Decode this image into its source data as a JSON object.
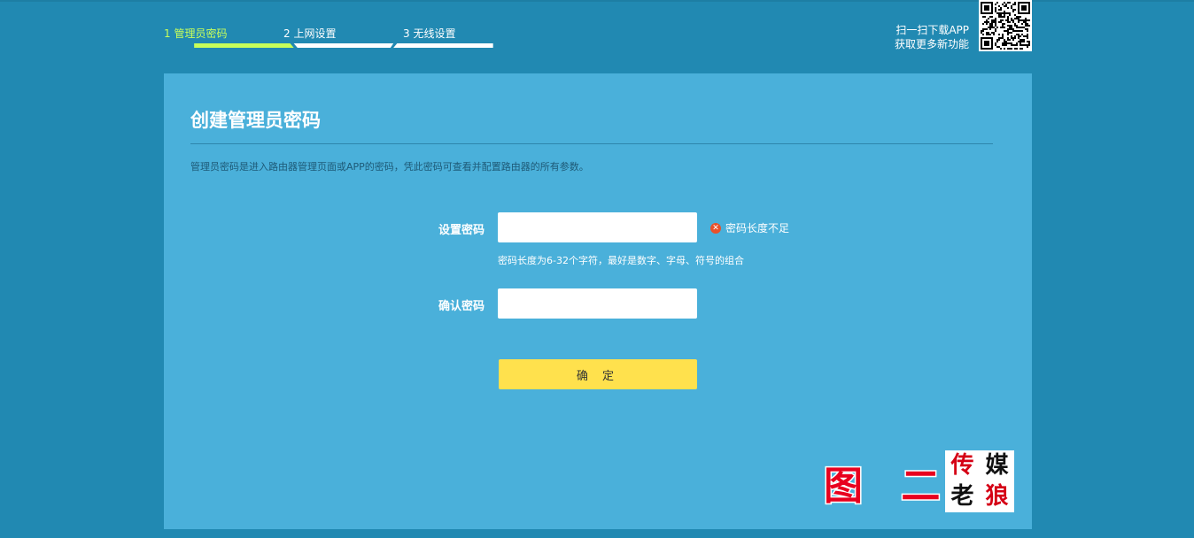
{
  "steps": [
    {
      "label": "1 管理员密码",
      "active": true
    },
    {
      "label": "2 上网设置",
      "active": false
    },
    {
      "label": "3 无线设置",
      "active": false
    }
  ],
  "app_download": {
    "line1": "扫一扫下载APP",
    "line2": "获取更多新功能",
    "icon": "qr-code-icon"
  },
  "panel": {
    "title": "创建管理员密码",
    "description": "管理员密码是进入路由器管理页面或APP的密码，凭此密码可查看并配置路由器的所有参数。",
    "set_password": {
      "label": "设置密码",
      "value": "",
      "error": "密码长度不足",
      "hint": "密码长度为6-32个字符，最好是数字、字母、符号的组合"
    },
    "confirm_password": {
      "label": "确认密码",
      "value": ""
    },
    "submit_label": "确 定"
  },
  "watermark": {
    "text": "图 二"
  },
  "logo": {
    "chars": [
      "传",
      "媒",
      "老",
      "狼"
    ]
  },
  "colors": {
    "background": "#2189b2",
    "panel": "#4ab0da",
    "active_step": "#c8ff5a",
    "button": "#ffe14d",
    "error": "#e8502a"
  }
}
